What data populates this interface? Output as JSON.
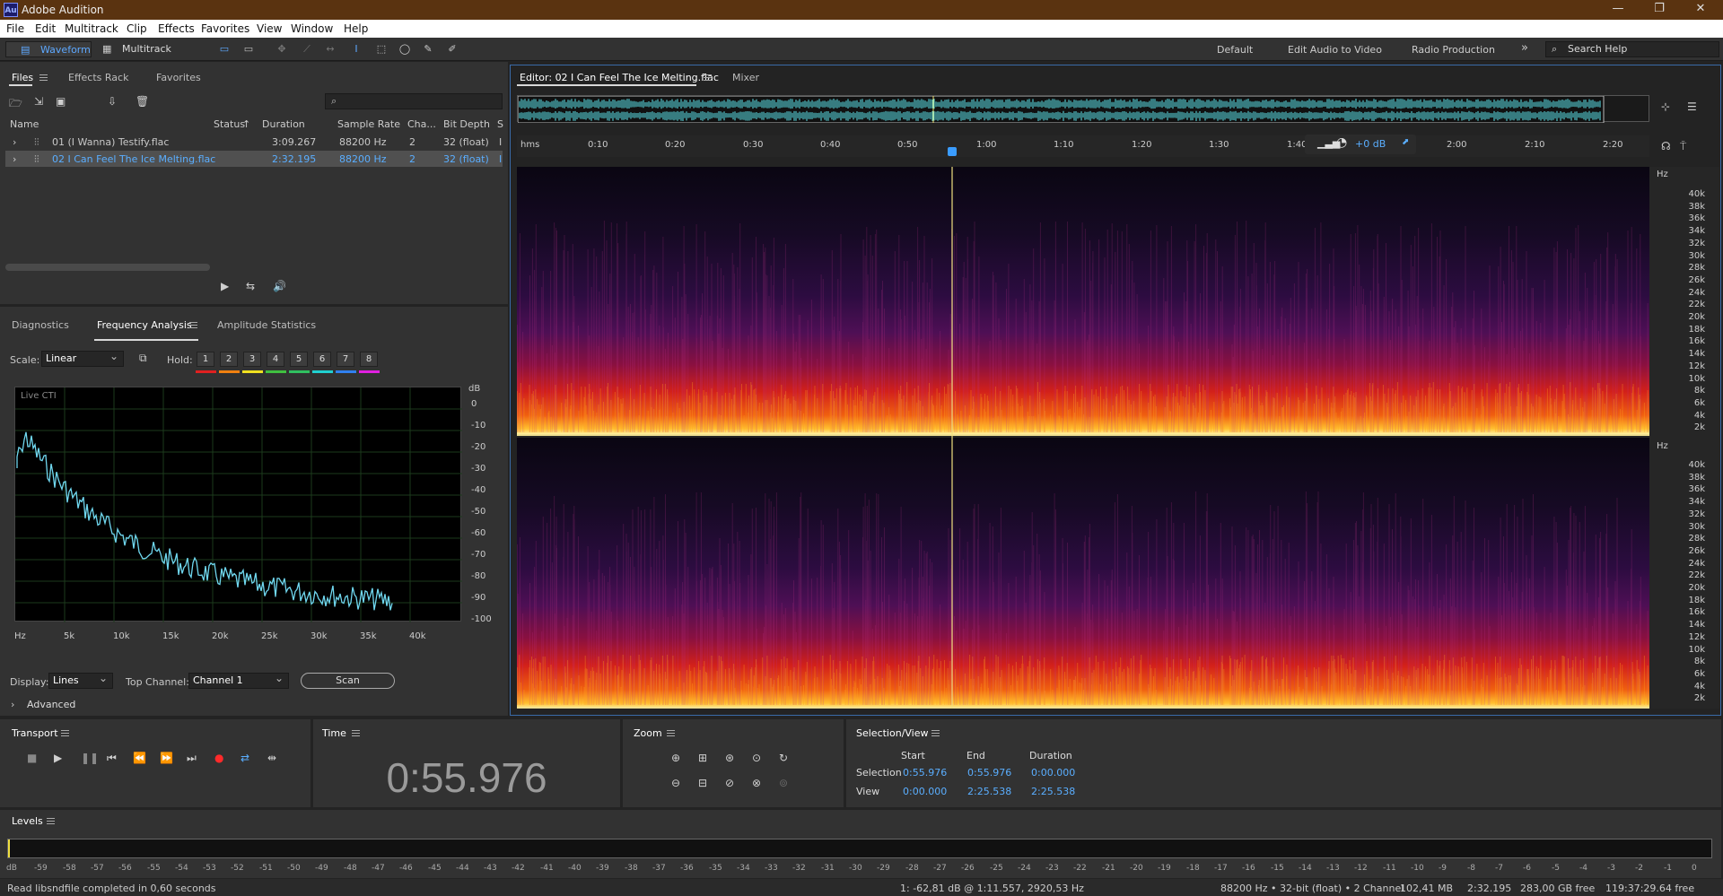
{
  "app": {
    "title": "Adobe Audition",
    "logo": "Au"
  },
  "menu": [
    "File",
    "Edit",
    "Multitrack",
    "Clip",
    "Effects",
    "Favorites",
    "View",
    "Window",
    "Help"
  ],
  "toolbar": {
    "waveform": "Waveform",
    "multitrack": "Multitrack"
  },
  "workspaces": [
    "Default",
    "Edit Audio to Video",
    "Radio Production"
  ],
  "search_help": "Search Help",
  "files_panel": {
    "tabs": [
      "Files",
      "Effects Rack",
      "Favorites"
    ],
    "columns": [
      "Name",
      "Status",
      "Duration",
      "Sample Rate",
      "Cha...",
      "Bit Depth",
      "S"
    ],
    "rows": [
      {
        "name": "01 (I Wanna) Testify.flac",
        "duration": "3:09.267",
        "sample_rate": "88200 Hz",
        "channels": "2",
        "bit_depth": "32 (float)",
        "s": "I"
      },
      {
        "name": "02 I Can Feel The Ice Melting.flac",
        "duration": "2:32.195",
        "sample_rate": "88200 Hz",
        "channels": "2",
        "bit_depth": "32 (float)",
        "s": "I"
      }
    ]
  },
  "analysis_panel": {
    "tabs": [
      "Diagnostics",
      "Frequency Analysis",
      "Amplitude Statistics"
    ],
    "scale_label": "Scale:",
    "scale_value": "Linear",
    "hold_label": "Hold:",
    "holds": [
      "1",
      "2",
      "3",
      "4",
      "5",
      "6",
      "7",
      "8"
    ],
    "hold_colors": [
      "#e02020",
      "#f08010",
      "#f0e020",
      "#40c040",
      "#30c060",
      "#20d0d0",
      "#3080f0",
      "#e020e0"
    ],
    "live_cti": "Live CTI",
    "db_label": "dB",
    "db_ticks": [
      "0",
      "-10",
      "-20",
      "-30",
      "-40",
      "-50",
      "-60",
      "-70",
      "-80",
      "-90",
      "-100"
    ],
    "hz_ticks": [
      "Hz",
      "5k",
      "10k",
      "15k",
      "20k",
      "25k",
      "30k",
      "35k",
      "40k"
    ],
    "display_label": "Display:",
    "display_value": "Lines",
    "top_channel_label": "Top Channel:",
    "top_channel_value": "Channel 1",
    "scan": "Scan",
    "advanced": "Advanced"
  },
  "editor": {
    "tab": "Editor: 02 I Can Feel The Ice Melting.flac",
    "mixer": "Mixer",
    "ruler": [
      "hms",
      "0:10",
      "0:20",
      "0:30",
      "0:40",
      "0:50",
      "1:00",
      "1:10",
      "1:20",
      "1:30",
      "1:40",
      "2:00",
      "2:10",
      "2:20"
    ],
    "volume": "+0 dB",
    "hz_unit": "Hz",
    "hz_labels": [
      "40k",
      "38k",
      "36k",
      "34k",
      "32k",
      "30k",
      "28k",
      "26k",
      "24k",
      "22k",
      "20k",
      "18k",
      "16k",
      "14k",
      "12k",
      "10k",
      "8k",
      "6k",
      "4k",
      "2k"
    ]
  },
  "transport": {
    "title": "Transport"
  },
  "time": {
    "title": "Time",
    "value": "0:55.976"
  },
  "zoom": {
    "title": "Zoom"
  },
  "selection_view": {
    "title": "Selection/View",
    "headers": [
      "Start",
      "End",
      "Duration"
    ],
    "selection_label": "Selection",
    "view_label": "View",
    "selection": [
      "0:55.976",
      "0:55.976",
      "0:00.000"
    ],
    "view": [
      "0:00.000",
      "2:25.538",
      "2:25.538"
    ]
  },
  "levels": {
    "title": "Levels",
    "ticks": [
      "dB",
      "-59",
      "-58",
      "-57",
      "-56",
      "-55",
      "-54",
      "-53",
      "-52",
      "-51",
      "-50",
      "-49",
      "-48",
      "-47",
      "-46",
      "-45",
      "-44",
      "-43",
      "-42",
      "-41",
      "-40",
      "-39",
      "-38",
      "-37",
      "-36",
      "-35",
      "-34",
      "-33",
      "-32",
      "-31",
      "-30",
      "-29",
      "-28",
      "-27",
      "-26",
      "-25",
      "-24",
      "-23",
      "-22",
      "-21",
      "-20",
      "-19",
      "-18",
      "-17",
      "-16",
      "-15",
      "-14",
      "-13",
      "-12",
      "-11",
      "-10",
      "-9",
      "-8",
      "-7",
      "-6",
      "-5",
      "-4",
      "-3",
      "-2",
      "-1",
      "0"
    ]
  },
  "status": {
    "message": "Read libsndfile completed in 0,60 seconds",
    "cursor": "1: -62,81 dB @ 1:11.557, 2920,53 Hz",
    "format": "88200 Hz • 32-bit (float) • 2 Channel",
    "size": "102,41 MB",
    "duration": "2:32.195",
    "free": "283,00 GB free",
    "free_time": "119:37:29.64 free"
  }
}
